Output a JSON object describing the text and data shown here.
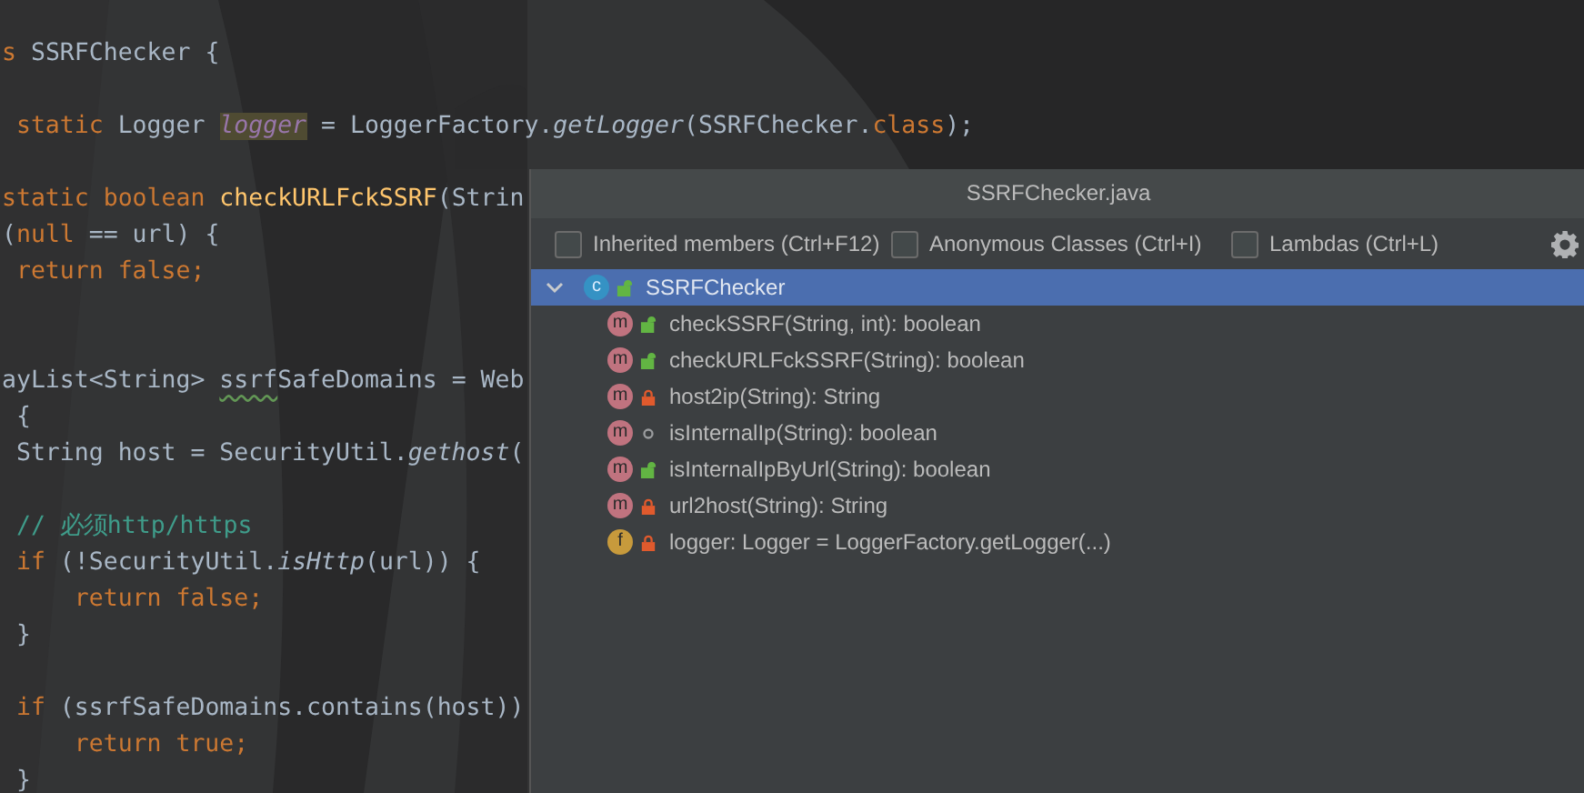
{
  "editor": {
    "lines": [
      {
        "kind": "code",
        "tokens": [
          {
            "text": "s ",
            "kind": "keyword"
          },
          {
            "text": "SSRFChecker {",
            "kind": "plain"
          }
        ]
      },
      {
        "kind": "blank"
      },
      {
        "kind": "code",
        "tokens": [
          {
            "text": " static ",
            "kind": "keyword"
          },
          {
            "text": "Logger ",
            "kind": "plain"
          },
          {
            "text": "logger",
            "kind": "highlighted-field"
          },
          {
            "text": " = LoggerFactory.",
            "kind": "plain"
          },
          {
            "text": "getLogger",
            "kind": "static-call"
          },
          {
            "text": "(SSRFChecker.",
            "kind": "plain"
          },
          {
            "text": "class",
            "kind": "keyword"
          },
          {
            "text": ");",
            "kind": "plain"
          }
        ]
      },
      {
        "kind": "blank"
      },
      {
        "kind": "code",
        "tokens": [
          {
            "text": "static boolean ",
            "kind": "keyword"
          },
          {
            "text": "checkURLFckSSRF",
            "kind": "method-def"
          },
          {
            "text": "(Strin",
            "kind": "plain"
          }
        ]
      },
      {
        "kind": "code",
        "tokens": [
          {
            "text": "(",
            "kind": "plain"
          },
          {
            "text": "null ",
            "kind": "keyword"
          },
          {
            "text": "== url) {",
            "kind": "plain"
          }
        ]
      },
      {
        "kind": "code",
        "tokens": [
          {
            "text": " return false",
            "kind": "keyword"
          },
          {
            "text": ";",
            "kind": "keyword"
          }
        ]
      },
      {
        "kind": "blank"
      },
      {
        "kind": "blank"
      },
      {
        "kind": "code",
        "tokens": [
          {
            "text": "ayList<String> ",
            "kind": "plain"
          },
          {
            "text": "ssrf",
            "kind": "typo"
          },
          {
            "text": "SafeDomains = Web",
            "kind": "plain"
          }
        ]
      },
      {
        "kind": "code",
        "tokens": [
          {
            "text": " {",
            "kind": "plain"
          }
        ]
      },
      {
        "kind": "code",
        "tokens": [
          {
            "text": " String host = SecurityUtil.",
            "kind": "plain"
          },
          {
            "text": "gethost",
            "kind": "static-call"
          },
          {
            "text": "(",
            "kind": "plain"
          }
        ]
      },
      {
        "kind": "blank"
      },
      {
        "kind": "code",
        "tokens": [
          {
            "text": " // 必须http/https",
            "kind": "comment"
          }
        ]
      },
      {
        "kind": "code",
        "tokens": [
          {
            "text": " if ",
            "kind": "keyword"
          },
          {
            "text": "(!SecurityUtil.",
            "kind": "plain"
          },
          {
            "text": "isHttp",
            "kind": "static-call"
          },
          {
            "text": "(url)) {",
            "kind": "plain"
          }
        ]
      },
      {
        "kind": "code",
        "tokens": [
          {
            "text": "     return false;",
            "kind": "keyword"
          }
        ]
      },
      {
        "kind": "code",
        "tokens": [
          {
            "text": " }",
            "kind": "plain"
          }
        ]
      },
      {
        "kind": "blank"
      },
      {
        "kind": "code",
        "tokens": [
          {
            "text": " if ",
            "kind": "keyword"
          },
          {
            "text": "(ssrfSafeDomains.contains(host))",
            "kind": "plain"
          }
        ]
      },
      {
        "kind": "code",
        "tokens": [
          {
            "text": "     return true;",
            "kind": "keyword"
          }
        ]
      },
      {
        "kind": "code",
        "tokens": [
          {
            "text": " }",
            "kind": "plain"
          }
        ]
      }
    ]
  },
  "structure_popup": {
    "title": "SSRFChecker.java",
    "options": [
      {
        "label": "Inherited members (Ctrl+F12)",
        "checked": false
      },
      {
        "label": "Anonymous Classes (Ctrl+I)",
        "checked": false
      },
      {
        "label": "Lambdas (Ctrl+L)",
        "checked": false
      }
    ],
    "tree": [
      {
        "label": "SSRFChecker",
        "kind": "class",
        "badge": "c",
        "access": {
          "kind": "public"
        },
        "expanded": true,
        "selected": true,
        "children": [
          {
            "label": "checkSSRF(String, int): boolean",
            "kind": "method",
            "badge": "m",
            "access": {
              "kind": "public"
            },
            "selected": false
          },
          {
            "label": "checkURLFckSSRF(String): boolean",
            "kind": "method",
            "badge": "m",
            "access": {
              "kind": "public"
            },
            "selected": false
          },
          {
            "label": "host2ip(String): String",
            "kind": "method",
            "badge": "m",
            "access": {
              "kind": "private"
            },
            "selected": false
          },
          {
            "label": "isInternalIp(String): boolean",
            "kind": "method",
            "badge": "m",
            "access": {
              "kind": "package"
            },
            "selected": false
          },
          {
            "label": "isInternalIpByUrl(String): boolean",
            "kind": "method",
            "badge": "m",
            "access": {
              "kind": "public"
            },
            "selected": false
          },
          {
            "label": "url2host(String): String",
            "kind": "method",
            "badge": "m",
            "access": {
              "kind": "private"
            },
            "selected": false
          },
          {
            "label": "logger: Logger = LoggerFactory.getLogger(...)",
            "kind": "field",
            "badge": "f",
            "access": {
              "kind": "private"
            },
            "selected": false
          }
        ]
      }
    ]
  }
}
